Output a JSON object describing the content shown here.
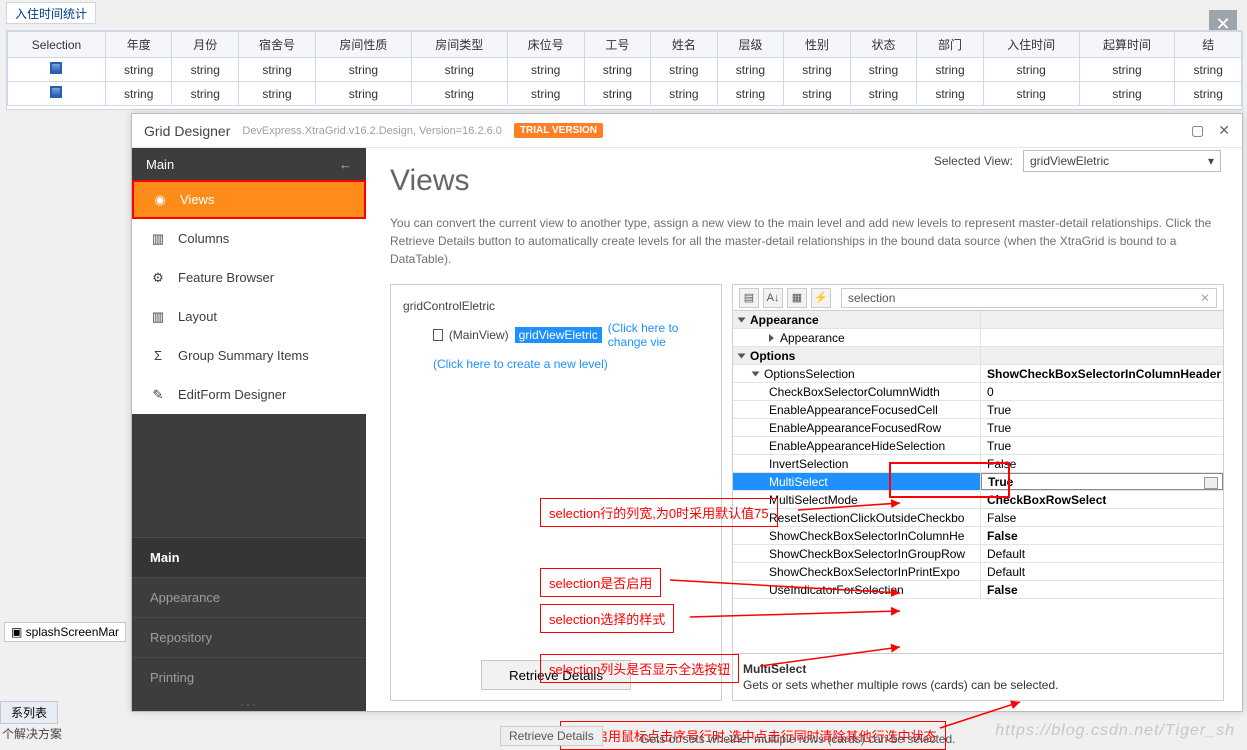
{
  "top_tab_title": "入住时间统计",
  "top_close": "✕",
  "grid": {
    "headers": [
      "Selection",
      "年度",
      "月份",
      "宿舍号",
      "房间性质",
      "房间类型",
      "床位号",
      "工号",
      "姓名",
      "层级",
      "性别",
      "状态",
      "部门",
      "入住时间",
      "起算时间",
      "结"
    ],
    "cell": "string"
  },
  "designer": {
    "title": "Grid Designer",
    "sub": "DevExpress.XtraGrid.v16.2.Design, Version=16.2.6.0",
    "trial": "TRIAL VERSION",
    "win": {
      "max": "▢",
      "close": "✕"
    },
    "left": {
      "header": "Main",
      "back": "←",
      "items": [
        {
          "icon": "eye-icon",
          "label": "Views",
          "active": true
        },
        {
          "icon": "columns-icon",
          "label": "Columns"
        },
        {
          "icon": "gear-icon",
          "label": "Feature Browser"
        },
        {
          "icon": "layout-icon",
          "label": "Layout"
        },
        {
          "icon": "sigma-icon",
          "label": "Group Summary Items"
        },
        {
          "icon": "edit-icon",
          "label": "EditForm Designer"
        }
      ],
      "sections": [
        "Main",
        "Appearance",
        "Repository",
        "Printing"
      ]
    },
    "views_title": "Views",
    "selected_view_label": "Selected View:",
    "selected_view": "gridViewEletric",
    "desc": "You can convert the current view to another type, assign a new view to the main level and add new levels to represent master-detail relationships. Click the Retrieve Details button to automatically create levels for all the master-detail relationships in the bound data source (when the XtraGrid is bound to a DataTable).",
    "tree": {
      "root": "gridControlEletric",
      "main_view": "(MainView)",
      "grid_view": "gridViewEletric",
      "link1": "(Click here to change vie",
      "link2": "(Click here to create a new level)",
      "retrieve": "Retrieve Details"
    },
    "prop": {
      "search": "selection",
      "cat_appearance": "Appearance",
      "appearance": "Appearance",
      "cat_options": "Options",
      "options_selection": "OptionsSelection",
      "options_selection_val": "ShowCheckBoxSelectorInColumnHeader",
      "rows": [
        {
          "k": "CheckBoxSelectorColumnWidth",
          "v": "0"
        },
        {
          "k": "EnableAppearanceFocusedCell",
          "v": "True"
        },
        {
          "k": "EnableAppearanceFocusedRow",
          "v": "True"
        },
        {
          "k": "EnableAppearanceHideSelection",
          "v": "True"
        },
        {
          "k": "InvertSelection",
          "v": "False"
        },
        {
          "k": "MultiSelect",
          "v": "True",
          "sel": true
        },
        {
          "k": "MultiSelectMode",
          "v": "CheckBoxRowSelect",
          "bold": true
        },
        {
          "k": "ResetSelectionClickOutsideCheckbo",
          "v": "False"
        },
        {
          "k": "ShowCheckBoxSelectorInColumnHe",
          "v": "False",
          "bold": true
        },
        {
          "k": "ShowCheckBoxSelectorInGroupRow",
          "v": "Default"
        },
        {
          "k": "ShowCheckBoxSelectorInPrintExpo",
          "v": "Default"
        },
        {
          "k": "UseIndicatorForSelection",
          "v": "False",
          "bold": true
        }
      ],
      "help_name": "MultiSelect",
      "help_desc": "Gets or sets whether multiple rows (cards) can be selected."
    }
  },
  "anno": {
    "a1": "selection行的列宽,为0时采用默认值75",
    "a2": "selection是否启用",
    "a3": "selection选择的样式",
    "a4": "selection列头是否显示全选按钮",
    "a5": "是否启用鼠标点击序号行时,选中点击行同时清除其他行选中状态"
  },
  "splash": "splashScreenMar",
  "tree_tab": "系列表",
  "solution": "个解决方案",
  "watermark": "https://blog.csdn.net/Tiger_sh",
  "stray_retrieve": "Retrieve Details",
  "stray_help": "Gets or sets whether multiple rows (cards) can be selected."
}
